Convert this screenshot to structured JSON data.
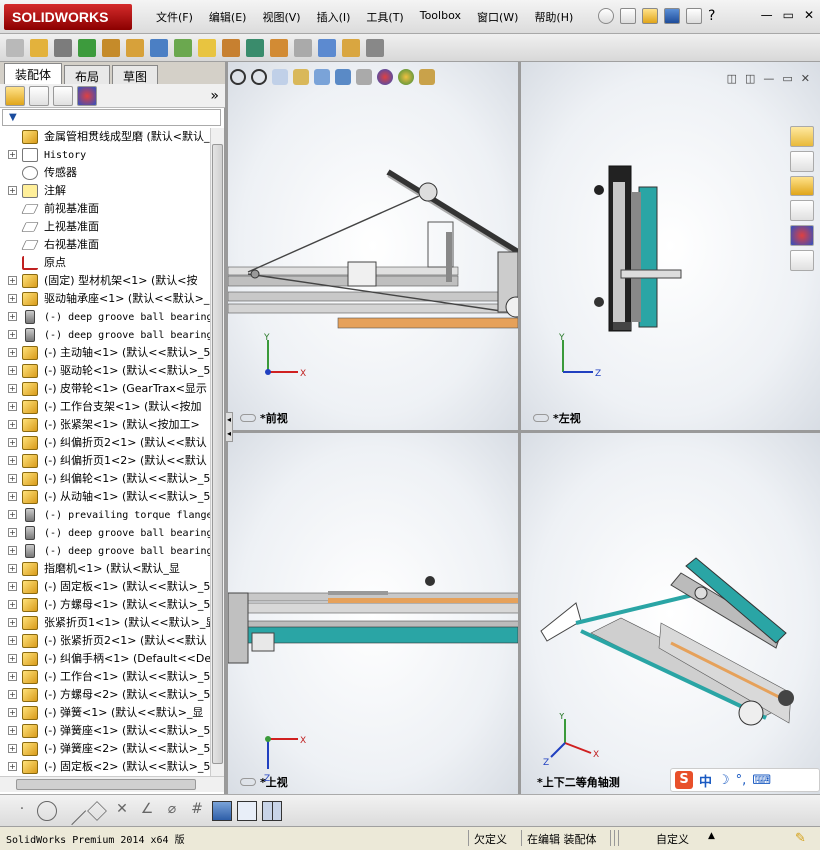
{
  "app": {
    "title": "SOLIDWORKS"
  },
  "menu": [
    "文件(F)",
    "编辑(E)",
    "视图(V)",
    "插入(I)",
    "工具(T)",
    "Toolbox",
    "窗口(W)",
    "帮助(H)"
  ],
  "window_controls": {
    "minimize": "—",
    "restore": "▭",
    "close": "✕"
  },
  "tabs": [
    "装配体",
    "布局",
    "草图"
  ],
  "filter": "▼",
  "tree": [
    {
      "label": "金属管相贯线成型磨  (默认<默认_",
      "icon": "assembly-icon",
      "expander": ""
    },
    {
      "label": "History",
      "icon": "history-icon",
      "expander": "+",
      "mono": true
    },
    {
      "label": "传感器",
      "icon": "sensor-icon",
      "expander": ""
    },
    {
      "label": "注解",
      "icon": "annotation-icon",
      "expander": "+"
    },
    {
      "label": "前视基准面",
      "icon": "plane-icon",
      "expander": ""
    },
    {
      "label": "上视基准面",
      "icon": "plane-icon",
      "expander": ""
    },
    {
      "label": "右视基准面",
      "icon": "plane-icon",
      "expander": ""
    },
    {
      "label": "原点",
      "icon": "origin-icon",
      "expander": ""
    },
    {
      "label": "(固定) 型材机架<1> (默认<按",
      "icon": "part-icon",
      "expander": "+"
    },
    {
      "label": "驱动轴承座<1> (默认<<默认>_5",
      "icon": "part-icon",
      "expander": "+"
    },
    {
      "label": "(-) deep groove ball bearing",
      "icon": "bolt-icon",
      "expander": "+",
      "mono": true
    },
    {
      "label": "(-) deep groove ball bearing",
      "icon": "bolt-icon",
      "expander": "+",
      "mono": true
    },
    {
      "label": "(-) 主动轴<1> (默认<<默认>_5",
      "icon": "part-icon",
      "expander": "+"
    },
    {
      "label": "(-) 驱动轮<1> (默认<<默认>_5",
      "icon": "part-icon",
      "expander": "+"
    },
    {
      "label": "(-) 皮带轮<1> (GearTrax<显示",
      "icon": "part-icon",
      "expander": "+"
    },
    {
      "label": "(-) 工作台支架<1> (默认<按加",
      "icon": "part-icon",
      "expander": "+"
    },
    {
      "label": "(-) 张紧架<1> (默认<按加工>",
      "icon": "part-icon",
      "expander": "+"
    },
    {
      "label": "(-) 纠偏折页2<1> (默认<<默认",
      "icon": "part-icon",
      "expander": "+"
    },
    {
      "label": "(-) 纠偏折页1<2> (默认<<默认",
      "icon": "part-icon",
      "expander": "+"
    },
    {
      "label": "(-) 纠偏轮<1> (默认<<默认>_5",
      "icon": "part-icon",
      "expander": "+"
    },
    {
      "label": "(-) 从动轴<1> (默认<<默认>_5",
      "icon": "part-icon",
      "expander": "+"
    },
    {
      "label": "(-) prevailing torque flange",
      "icon": "bolt-icon",
      "expander": "+",
      "mono": true
    },
    {
      "label": "(-) deep groove ball bearing",
      "icon": "bolt-icon",
      "expander": "+",
      "mono": true
    },
    {
      "label": "(-) deep groove ball bearing",
      "icon": "bolt-icon",
      "expander": "+",
      "mono": true
    },
    {
      "label": "指磨机<1> (默认<默认_显",
      "icon": "assembly-icon",
      "expander": "+"
    },
    {
      "label": "(-) 固定板<1> (默认<<默认>_5",
      "icon": "part-icon",
      "expander": "+"
    },
    {
      "label": "(-) 方螺母<1> (默认<<默认>_5",
      "icon": "part-icon",
      "expander": "+"
    },
    {
      "label": "张紧折页1<1> (默认<<默认>_显",
      "icon": "part-icon",
      "expander": "+"
    },
    {
      "label": "(-) 张紧折页2<1> (默认<<默认",
      "icon": "part-icon",
      "expander": "+"
    },
    {
      "label": "(-) 纠偏手柄<1> (Default<<De",
      "icon": "part-icon",
      "expander": "+"
    },
    {
      "label": "(-) 工作台<1> (默认<<默认>_5",
      "icon": "part-icon",
      "expander": "+"
    },
    {
      "label": "(-) 方螺母<2> (默认<<默认>_5",
      "icon": "part-icon",
      "expander": "+"
    },
    {
      "label": "(-) 弹簧<1> (默认<<默认>_显",
      "icon": "part-icon",
      "expander": "+"
    },
    {
      "label": "(-) 弹簧座<1> (默认<<默认>_5",
      "icon": "part-icon",
      "expander": "+"
    },
    {
      "label": "(-) 弹簧座<2> (默认<<默认>_5",
      "icon": "part-icon",
      "expander": "+"
    },
    {
      "label": "(-) 固定板<2> (默认<<默认>_5",
      "icon": "part-icon",
      "expander": "+"
    }
  ],
  "viewports": {
    "front": "*前视",
    "left": "*左视",
    "top": "*上视",
    "iso": "*上下二等角轴测"
  },
  "axes": {
    "x": "X",
    "y": "Y",
    "z": "Z"
  },
  "status": {
    "product": "SolidWorks Premium 2014 x64 版",
    "underdefined": "欠定义",
    "editing": "在编辑 装配体",
    "custom": "自定义"
  },
  "ime": {
    "label": "中"
  }
}
